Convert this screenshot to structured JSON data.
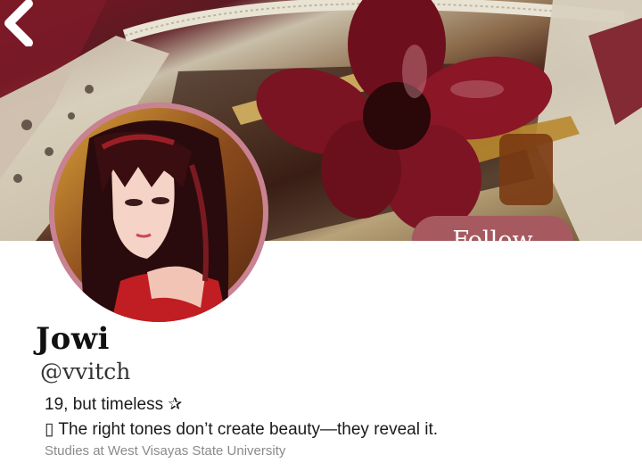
{
  "profile": {
    "name": "Jowi",
    "handle": "@vvitch",
    "bio_line_1": "19, but timeless ✰",
    "bio_line_2": "▯ The right tones don’t create beauty—they reveal it.",
    "school": "Studies at West Visayas State University"
  },
  "actions": {
    "follow_label": "Follow"
  },
  "icons": {
    "back": "chevron-left-icon"
  },
  "colors": {
    "follow_button": "#a65a5f",
    "banner_accent": "#7a1524"
  }
}
